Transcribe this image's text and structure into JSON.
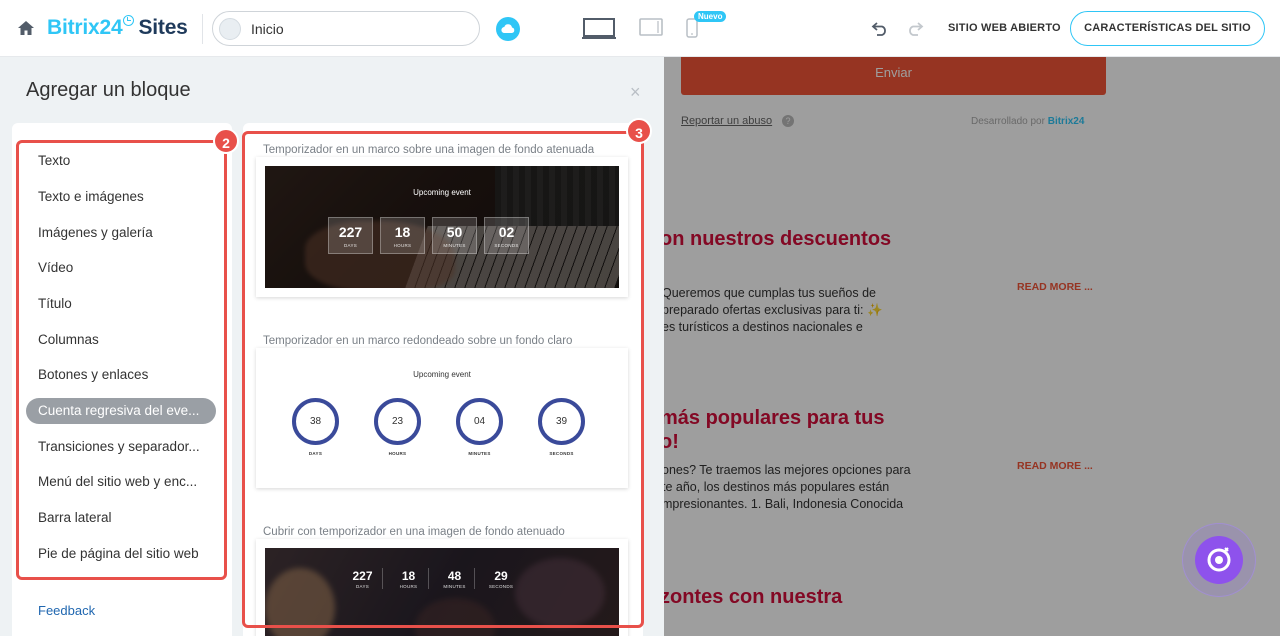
{
  "topbar": {
    "brand_main": "Bitrix24",
    "brand_sites": "Sites",
    "page_select_value": "Inicio",
    "badge_new": "Nuevo",
    "open_site_label": "SITIO WEB ABIERTO",
    "features_label": "CARACTERÍSTICAS DEL SITIO"
  },
  "panel": {
    "title": "Agregar un bloque",
    "close": "×",
    "categories": [
      "Texto",
      "Texto e imágenes",
      "Imágenes y galería",
      "Vídeo",
      "Título",
      "Columnas",
      "Botones y enlaces",
      "Cuenta regresiva del eve...",
      "Transiciones y separador...",
      "Menú del sitio web y enc...",
      "Barra lateral",
      "Pie de página del sitio web"
    ],
    "active_category_index": 7,
    "feedback": "Feedback"
  },
  "blocks": [
    {
      "caption": "Temporizador en un marco sobre una imagen de fondo atenuada",
      "event_title": "Upcoming event",
      "timer": [
        {
          "value": "227",
          "unit": "DAYS"
        },
        {
          "value": "18",
          "unit": "HOURS"
        },
        {
          "value": "50",
          "unit": "MINUTES"
        },
        {
          "value": "02",
          "unit": "SECONDS"
        }
      ]
    },
    {
      "caption": "Temporizador en un marco redondeado sobre un fondo claro",
      "event_title": "Upcoming event",
      "timer": [
        {
          "value": "38",
          "unit": "DAYS"
        },
        {
          "value": "23",
          "unit": "HOURS"
        },
        {
          "value": "04",
          "unit": "MINUTES"
        },
        {
          "value": "39",
          "unit": "SECONDS"
        }
      ]
    },
    {
      "caption": "Cubrir con temporizador en una imagen de fondo atenuado",
      "timer": [
        {
          "value": "227",
          "unit": "DAYS"
        },
        {
          "value": "18",
          "unit": "HOURS"
        },
        {
          "value": "48",
          "unit": "MINUTES"
        },
        {
          "value": "29",
          "unit": "SECONDS"
        }
      ]
    }
  ],
  "callouts": {
    "categories": "2",
    "blocks": "3"
  },
  "preview": {
    "send_button": "Enviar",
    "abuse_link": "Reportar un abuso",
    "developed_by": "Desarrollado por",
    "developed_by_brand": "Bitrix24",
    "sections": [
      {
        "heading_lines": [
          "on nuestros descuentos"
        ],
        "text_lines": [
          "Queremos que cumplas tus sueños de",
          "preparado ofertas exclusivas para ti: ✨",
          "es turísticos a destinos nacionales e"
        ],
        "read_more": "READ MORE ..."
      },
      {
        "heading_lines": [
          "más populares para tus",
          "o!"
        ],
        "text_lines": [
          "ones? Te traemos las mejores opciones para",
          "te año, los destinos más populares están",
          "mpresionantes. 1. Bali, Indonesia Conocida"
        ],
        "read_more": "READ MORE ..."
      },
      {
        "heading_lines": [
          "zontes con nuestra"
        ]
      }
    ]
  },
  "colors": {
    "accent": "#2fc6f6",
    "highlight": "#e8504a",
    "heading_red": "#d30e3b",
    "send_orange": "#f25538",
    "copilot_purple": "#8e52ec"
  }
}
